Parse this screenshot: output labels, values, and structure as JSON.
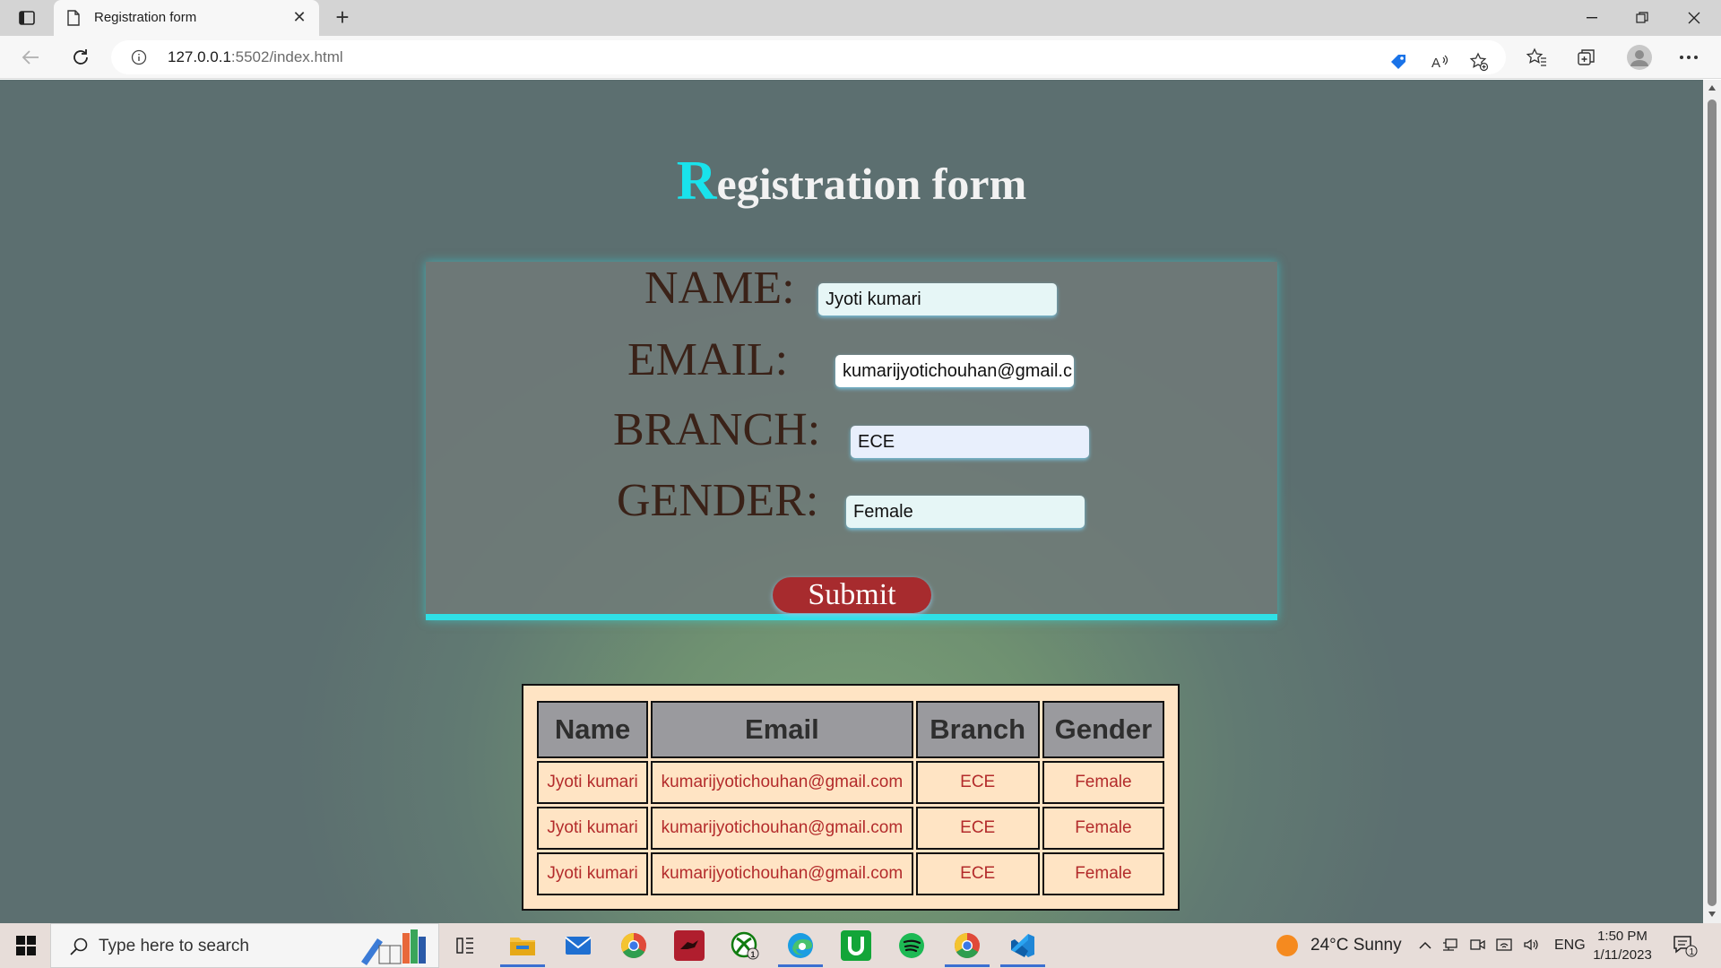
{
  "browser": {
    "tab_title": "Registration form",
    "url_host": "127.0.0.1",
    "url_rest": ":5502/index.html"
  },
  "page": {
    "heading_first": "R",
    "heading_rest": "egistration form",
    "form": {
      "name_label": "NAME:",
      "name_value": "Jyoti kumari",
      "email_label": "EMAIL:",
      "email_value": "kumarijyotichouhan@gmail.c",
      "branch_label": "BRANCH:",
      "branch_value": "ECE",
      "gender_label": "GENDER:",
      "gender_value": "Female",
      "submit_label": "Submit"
    },
    "table": {
      "headers": [
        "Name",
        "Email",
        "Branch",
        "Gender"
      ],
      "rows": [
        [
          "Jyoti kumari",
          "kumarijyotichouhan@gmail.com",
          "ECE",
          "Female"
        ],
        [
          "Jyoti kumari",
          "kumarijyotichouhan@gmail.com",
          "ECE",
          "Female"
        ],
        [
          "Jyoti kumari",
          "kumarijyotichouhan@gmail.com",
          "ECE",
          "Female"
        ]
      ]
    }
  },
  "taskbar": {
    "search_placeholder": "Type here to search",
    "weather": "24°C  Sunny",
    "language": "ENG",
    "time": "1:50 PM",
    "date": "1/11/2023",
    "xbox_badge": "1",
    "notification_count": "1"
  },
  "colors": {
    "heading_accent": "#19e3ec",
    "form_accent": "#2fe0e6",
    "submit_bg": "#a72b2e",
    "table_bg": "#ffe4c4",
    "cell_text": "#b32b2b"
  }
}
